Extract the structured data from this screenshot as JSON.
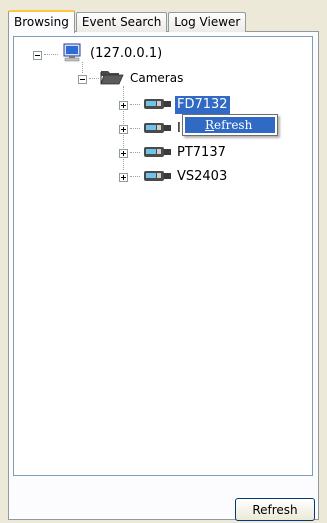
{
  "tabs": [
    {
      "label": "Browsing",
      "active": true
    },
    {
      "label": "Event Search",
      "active": false
    },
    {
      "label": "Log Viewer",
      "active": false
    }
  ],
  "tree": {
    "root": {
      "label": "(127.0.0.1)",
      "icon": "computer-icon",
      "expanded": true
    },
    "cameras_folder": {
      "label": "Cameras",
      "icon": "open-folder-icon",
      "expanded": true
    },
    "cameras": [
      {
        "label": "FD7132",
        "icon": "camera-icon",
        "selected": true,
        "expanded": false
      },
      {
        "label": "IP",
        "icon": "camera-icon",
        "selected": false,
        "expanded": false
      },
      {
        "label": "PT7137",
        "icon": "camera-icon",
        "selected": false,
        "expanded": false
      },
      {
        "label": "VS2403",
        "icon": "camera-icon",
        "selected": false,
        "expanded": false
      }
    ]
  },
  "context_menu": {
    "items": [
      {
        "accel": "R",
        "rest": "efresh"
      }
    ]
  },
  "buttons": {
    "refresh_label": "Refresh"
  },
  "colors": {
    "selection": "#316ac5",
    "active_tab_accent": "#ffc83c",
    "window_bg": "#ece9d8"
  }
}
